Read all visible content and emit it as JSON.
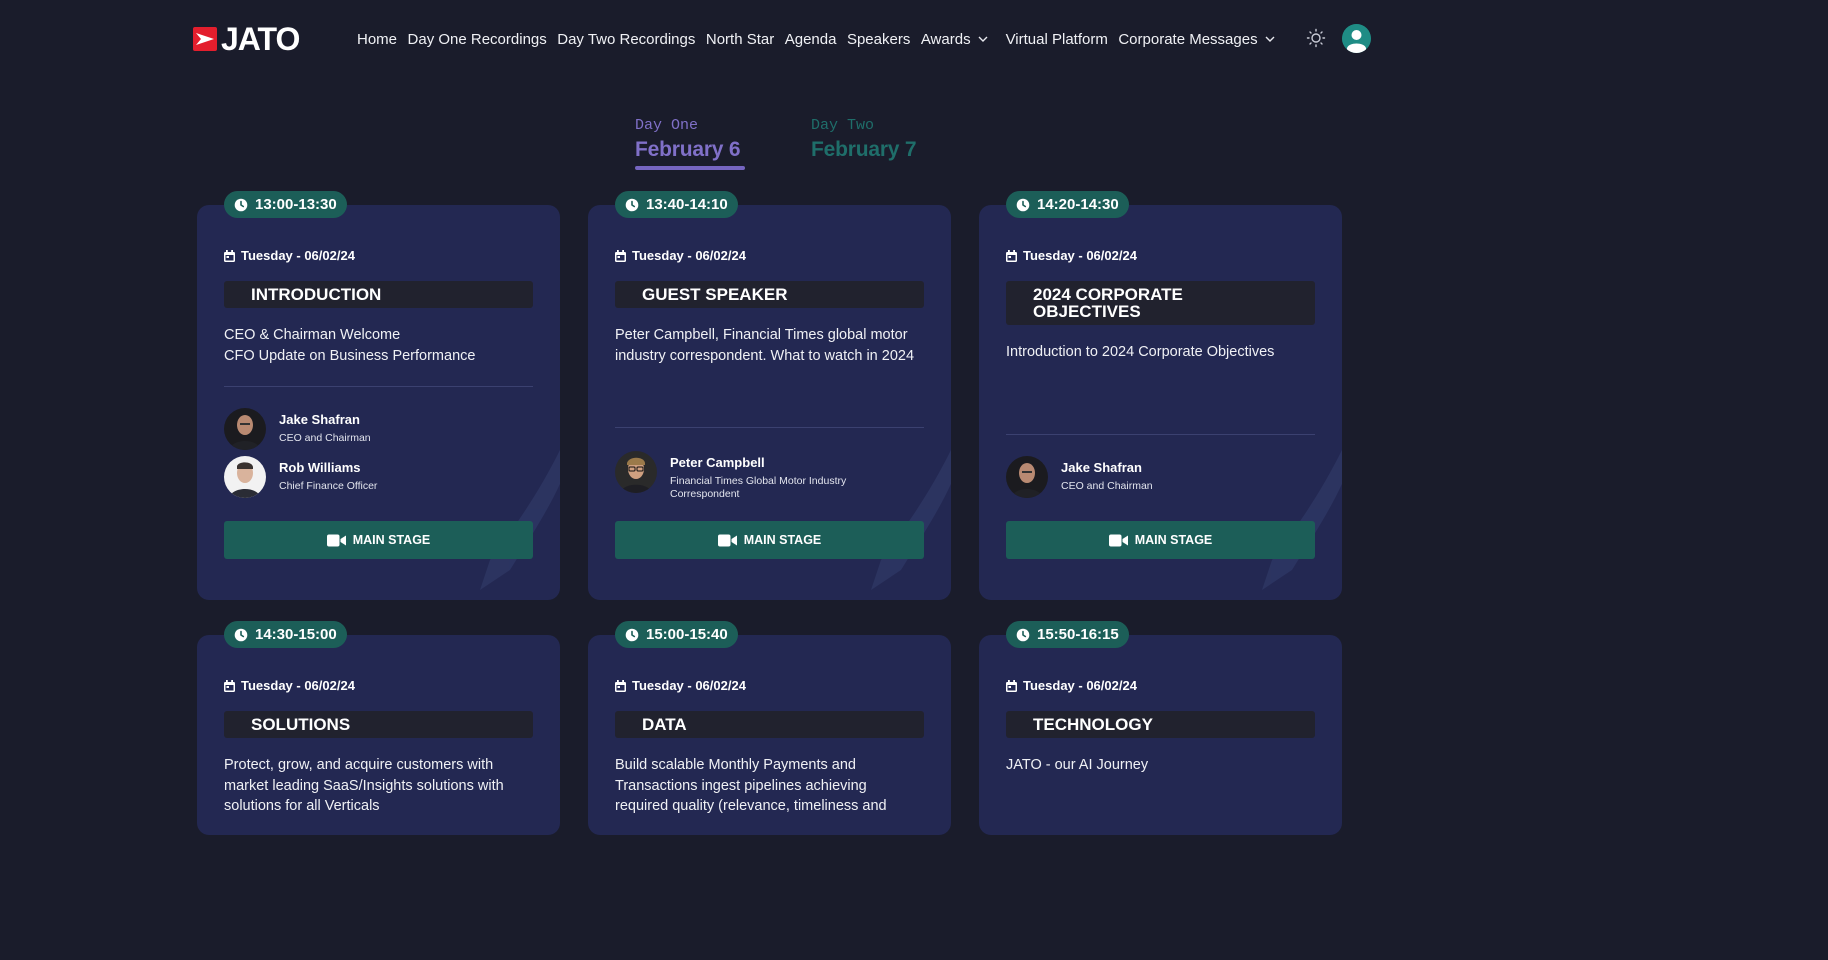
{
  "header": {
    "logo_text": "JATO",
    "nav": [
      {
        "label": "Home",
        "dropdown": false
      },
      {
        "label": "Day One Recordings",
        "dropdown": false
      },
      {
        "label": "Day Two Recordings",
        "dropdown": false
      },
      {
        "label": "North Star",
        "dropdown": false
      },
      {
        "label": "Agenda",
        "dropdown": false
      },
      {
        "label": "Speakers",
        "dropdown": false
      },
      {
        "label": "Awards",
        "dropdown": true
      },
      {
        "label": "Virtual Platform",
        "dropdown": false
      },
      {
        "label": "Corporate Messages",
        "dropdown": true
      }
    ],
    "theme_icon": "sun-icon",
    "user_icon": "user-avatar-icon"
  },
  "day_tabs": [
    {
      "label": "Day One",
      "date": "February 6",
      "active": true
    },
    {
      "label": "Day Two",
      "date": "February 7",
      "active": false
    }
  ],
  "sessions": [
    {
      "time": "13:00-13:30",
      "date": "Tuesday - 06/02/24",
      "topic": "INTRODUCTION",
      "description": [
        "CEO & Chairman Welcome",
        "CFO Update on Business Performance"
      ],
      "speakers": [
        {
          "name": "Jake Shafran",
          "role": "CEO and Chairman"
        },
        {
          "name": "Rob Williams",
          "role": "Chief Finance Officer"
        }
      ],
      "stage": "MAIN STAGE"
    },
    {
      "time": "13:40-14:10",
      "date": "Tuesday - 06/02/24",
      "topic": "GUEST SPEAKER",
      "description": [
        "Peter Campbell, Financial Times global motor industry correspondent. What to watch in 2024"
      ],
      "speakers": [
        {
          "name": "Peter Campbell",
          "role": "Financial Times Global Motor Industry Correspondent"
        }
      ],
      "stage": "MAIN STAGE"
    },
    {
      "time": "14:20-14:30",
      "date": "Tuesday - 06/02/24",
      "topic": "2024 CORPORATE OBJECTIVES",
      "description": [
        "Introduction to 2024 Corporate Objectives"
      ],
      "speakers": [
        {
          "name": "Jake Shafran",
          "role": "CEO and Chairman"
        }
      ],
      "stage": "MAIN STAGE"
    },
    {
      "time": "14:30-15:00",
      "date": "Tuesday - 06/02/24",
      "topic": "SOLUTIONS",
      "description": [
        "Protect, grow, and acquire customers with market leading SaaS/Insights solutions with solutions for all Verticals"
      ]
    },
    {
      "time": "15:00-15:40",
      "date": "Tuesday - 06/02/24",
      "topic": "DATA",
      "description": [
        "Build scalable Monthly Payments and Transactions ingest pipelines achieving required quality (relevance, timeliness and"
      ]
    },
    {
      "time": "15:50-16:15",
      "date": "Tuesday - 06/02/24",
      "topic": "TECHNOLOGY",
      "description": [
        "JATO - our AI Journey"
      ]
    }
  ],
  "colors": {
    "background": "#1a1c2b",
    "card": "#232852",
    "accent_teal": "#1c5e58",
    "accent_purple": "#7565c0",
    "brand_red": "#e31e2d"
  }
}
